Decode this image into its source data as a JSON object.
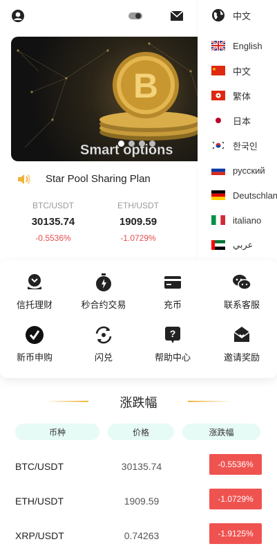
{
  "header": {
    "current_language": "中文",
    "icons": [
      "user-icon",
      "toggle-icon",
      "mail-icon",
      "globe-icon"
    ]
  },
  "banner": {
    "caption": "Smart options",
    "slide_count": 4,
    "active_slide": 1
  },
  "notice": {
    "text": "Star Pool Sharing Plan"
  },
  "tickers": [
    {
      "pair": "BTC/USDT",
      "price": "30135.74",
      "change": "-0.5536%"
    },
    {
      "pair": "ETH/USDT",
      "price": "1909.59",
      "change": "-1.0729%"
    }
  ],
  "languages": [
    {
      "label": "English",
      "flag": "uk"
    },
    {
      "label": "中文",
      "flag": "cn"
    },
    {
      "label": "繁体",
      "flag": "hk"
    },
    {
      "label": "日本",
      "flag": "jp"
    },
    {
      "label": "한국인",
      "flag": "kr"
    },
    {
      "label": "русский",
      "flag": "ru"
    },
    {
      "label": "Deutschland",
      "flag": "de"
    },
    {
      "label": "italiano",
      "flag": "it"
    },
    {
      "label": "عربي",
      "flag": "ae"
    }
  ],
  "menu": [
    {
      "label": "信托理财",
      "icon": "trust-icon"
    },
    {
      "label": "秒合约交易",
      "icon": "stopwatch-icon"
    },
    {
      "label": "充币",
      "icon": "card-icon"
    },
    {
      "label": "联系客服",
      "icon": "chat-icon"
    },
    {
      "label": "新币申购",
      "icon": "check-circle-icon"
    },
    {
      "label": "闪兑",
      "icon": "exchange-icon"
    },
    {
      "label": "帮助中心",
      "icon": "help-icon"
    },
    {
      "label": "邀请奖励",
      "icon": "invite-icon"
    }
  ],
  "market": {
    "title": "涨跌幅",
    "headers": [
      "币种",
      "价格",
      "涨跌幅"
    ],
    "rows": [
      {
        "symbol": "BTC/USDT",
        "price": "30135.74",
        "change": "-0.5536%"
      },
      {
        "symbol": "ETH/USDT",
        "price": "1909.59",
        "change": "-1.0729%"
      },
      {
        "symbol": "XRP/USDT",
        "price": "0.74263",
        "change": "-1.9125%"
      }
    ]
  },
  "colors": {
    "negative": "#ef5350",
    "change_text": "#e24c4c",
    "header_pill": "#e7fbf6",
    "accent_gold": "#f0b43a"
  }
}
